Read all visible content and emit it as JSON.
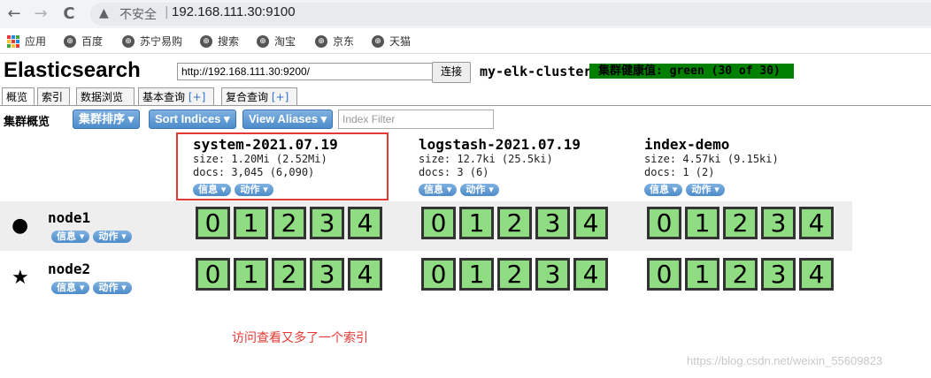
{
  "browser": {
    "back_icon": "←",
    "forward_icon": "→",
    "reload_icon": "C",
    "insecure_label": "不安全",
    "url": "192.168.111.30:9100",
    "bookmarks": [
      "应用",
      "百度",
      "苏宁易购",
      "搜索",
      "淘宝",
      "京东",
      "天猫"
    ]
  },
  "header": {
    "title": "Elasticsearch",
    "connect_url": "http://192.168.111.30:9200/",
    "connect_button": "连接",
    "cluster_name": "my-elk-cluster",
    "health": "集群健康值: green (30 of 30)",
    "health_color": "#008000"
  },
  "tabs": [
    {
      "label": "概览",
      "plus": ""
    },
    {
      "label": "索引",
      "plus": ""
    },
    {
      "label": "数据浏览",
      "plus": ""
    },
    {
      "label": "基本查询 ",
      "plus": "[+]"
    },
    {
      "label": "复合查询 ",
      "plus": "[+]"
    }
  ],
  "toolbar": {
    "label": "集群概览",
    "sort_cluster": "集群排序 ▾",
    "sort_indices": "Sort Indices ▾",
    "view_aliases": "View Aliases ▾",
    "filter_placeholder": "Index Filter"
  },
  "indices": [
    {
      "name": "system-2021.07.19",
      "size": "size: 1.20Mi (2.52Mi)",
      "docs": "docs: 3,045 (6,090)",
      "info": "信息 ▾",
      "action": "动作 ▾"
    },
    {
      "name": "logstash-2021.07.19",
      "size": "size: 12.7ki (25.5ki)",
      "docs": "docs: 3 (6)",
      "info": "信息 ▾",
      "action": "动作 ▾"
    },
    {
      "name": "index-demo",
      "size": "size: 4.57ki (9.15ki)",
      "docs": "docs: 1 (2)",
      "info": "信息 ▾",
      "action": "动作 ▾"
    }
  ],
  "nodes": [
    {
      "name": "node1",
      "icon": "●",
      "info": "信息 ▾",
      "action": "动作 ▾"
    },
    {
      "name": "node2",
      "icon": "★",
      "info": "信息 ▾",
      "action": "动作 ▾"
    }
  ],
  "shards": [
    "0",
    "1",
    "2",
    "3",
    "4"
  ],
  "annotation": "访问查看又多了一个索引",
  "watermark": "https://blog.csdn.net/weixin_55609823"
}
